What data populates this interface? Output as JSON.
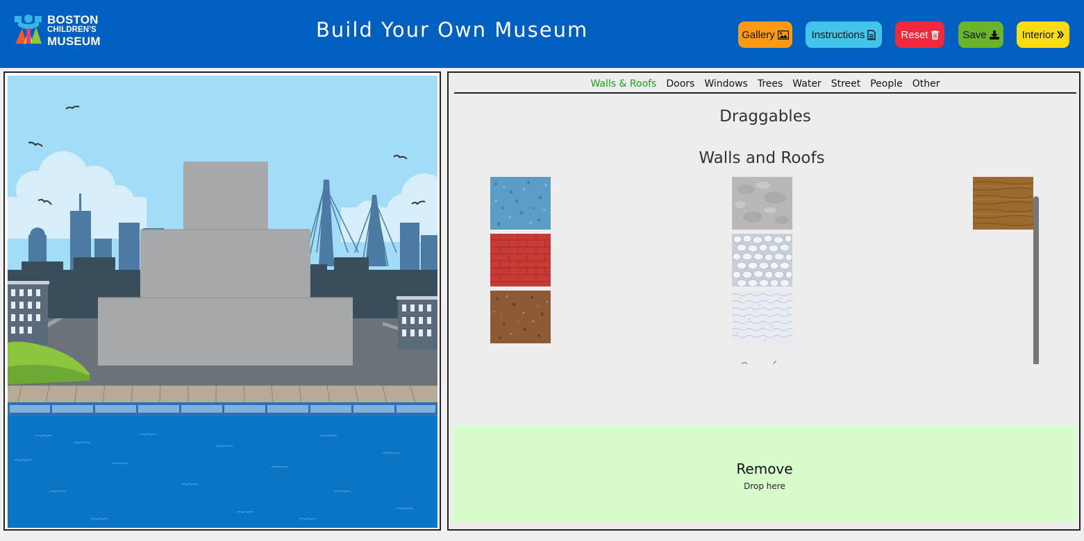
{
  "header": {
    "logo": {
      "line1": "BOSTON",
      "line2": "CHILDREN'S",
      "line3": "MUSEUM"
    },
    "title": "Build Your Own Museum",
    "buttons": {
      "gallery": "Gallery",
      "instructions": "Instructions",
      "reset": "Reset",
      "save": "Save",
      "interior": "Interior"
    }
  },
  "tabs": [
    "Walls & Roofs",
    "Doors",
    "Windows",
    "Trees",
    "Water",
    "Street",
    "People",
    "Other"
  ],
  "active_tab": "Walls & Roofs",
  "draggables": {
    "heading": "Draggables",
    "section_title": "Walls and Roofs",
    "tiles": [
      {
        "name": "blue-stone-texture",
        "color": "#5b9dc4"
      },
      {
        "name": "red-brick-texture",
        "color": "#c73a36"
      },
      {
        "name": "brown-gravel-texture",
        "color": "#8e5a35"
      },
      {
        "name": "gray-concrete-texture",
        "color": "#b9b8b6"
      },
      {
        "name": "white-pebble-texture",
        "color": "#dfe3e8"
      },
      {
        "name": "white-mosaic-texture",
        "color": "#e8ecf2"
      },
      {
        "name": "wood-plank-texture",
        "color": "#9a6a2e"
      }
    ]
  },
  "remove_zone": {
    "title": "Remove",
    "subtitle": "Drop here"
  },
  "colors": {
    "header_bg": "#0160bf",
    "active_tab": "#1aa01a",
    "gallery": "#fc9a14",
    "instructions": "#43c4ea",
    "reset": "#ee2a3c",
    "save": "#6ab42b",
    "interior": "#f9dc13",
    "remove_zone": "#d8fccc"
  }
}
